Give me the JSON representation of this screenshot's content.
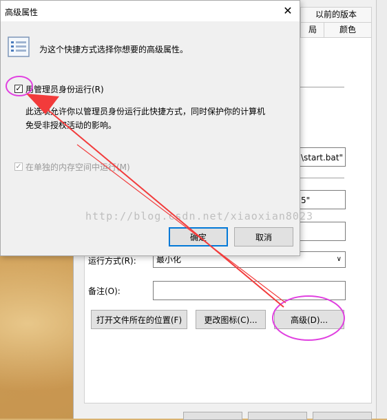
{
  "background_dialog": {
    "tabs_row1": [
      "以前的版本"
    ],
    "tabs_row2": [
      "局",
      "颜色"
    ],
    "target_value": "\\start.bat\"",
    "start_in_value": "5\"",
    "run_label": "运行方式(R):",
    "run_value": "最小化",
    "comment_label": "备注(O):",
    "comment_value": "",
    "open_location_button": "打开文件所在的位置(F)",
    "change_icon_button": "更改图标(C)...",
    "advanced_button": "高级(D)..."
  },
  "advanced_dialog": {
    "title": "高级属性",
    "description": "为这个快捷方式选择你想要的高级属性。",
    "run_as_admin_label": "用管理员身份运行(R)",
    "run_as_admin_checked": true,
    "info_line1": "此选项允许你以管理员身份运行此快捷方式，同时保护你的计算机",
    "info_line2": "免受非授权活动的影响。",
    "separate_memory_label": "在单独的内存空间中运行(M)",
    "separate_memory_checked": true,
    "ok_button": "确定",
    "cancel_button": "取消"
  },
  "watermark": "http://blog.csdn.net/xiaoxian8023",
  "colors": {
    "annotation_red": "#f23b3b",
    "highlight_magenta": "#e040e0",
    "focus_blue": "#0078d7"
  },
  "icons": {
    "close": "close-icon",
    "properties": "properties-list-icon",
    "checkmark": "checkmark-icon",
    "dropdown": "chevron-down-icon"
  }
}
